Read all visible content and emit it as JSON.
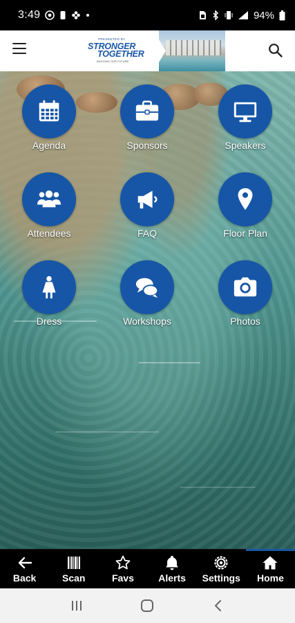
{
  "status_bar": {
    "time": "3:49",
    "battery": "94%",
    "left_icons": [
      "snapchat-icon",
      "cloud-icon",
      "phone-icon",
      "dot-icon"
    ],
    "right_icons": [
      "sim-icon",
      "bluetooth-icon",
      "vibrate-icon",
      "signal-icon",
      "battery-icon"
    ]
  },
  "header": {
    "menu_icon": "hamburger-icon",
    "search_icon": "search-icon",
    "banner": {
      "kicker": "PRESENTED BY",
      "title_line1": "STRONGER",
      "title_line2": "TOGETHER",
      "tagline": "BUILDING OUR FUTURE"
    }
  },
  "tiles": [
    {
      "label": "Agenda",
      "icon": "calendar-icon"
    },
    {
      "label": "Sponsors",
      "icon": "briefcase-icon"
    },
    {
      "label": "Speakers",
      "icon": "monitor-icon"
    },
    {
      "label": "Attendees",
      "icon": "people-icon"
    },
    {
      "label": "FAQ",
      "icon": "megaphone-icon"
    },
    {
      "label": "Floor Plan",
      "icon": "map-pin-icon"
    },
    {
      "label": "Dress",
      "icon": "person-dress-icon"
    },
    {
      "label": "Workshops",
      "icon": "chat-bubbles-icon"
    },
    {
      "label": "Photos",
      "icon": "camera-icon"
    }
  ],
  "bottom_nav": [
    {
      "label": "Back",
      "icon": "arrow-left-icon",
      "active": false
    },
    {
      "label": "Scan",
      "icon": "barcode-icon",
      "active": false
    },
    {
      "label": "Favs",
      "icon": "star-icon",
      "active": false
    },
    {
      "label": "Alerts",
      "icon": "bell-icon",
      "active": false
    },
    {
      "label": "Settings",
      "icon": "gear-icon",
      "active": false
    },
    {
      "label": "Home",
      "icon": "home-icon",
      "active": true
    }
  ],
  "system_nav": [
    "recent-apps-icon",
    "home-circle-icon",
    "back-chevron-icon"
  ],
  "colors": {
    "accent": "#1756a6",
    "header_bg": "#ffffff",
    "nav_bg": "#000000",
    "system_nav_bg": "#f2f2f2"
  }
}
